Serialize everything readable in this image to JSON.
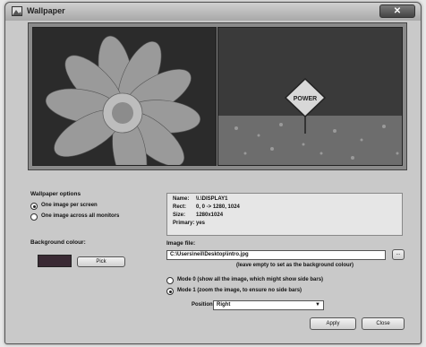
{
  "window": {
    "title": "Wallpaper",
    "close_glyph": "✕"
  },
  "preview": {
    "sign_text": "POWER"
  },
  "wallpaper_options": {
    "heading": "Wallpaper options",
    "options": [
      {
        "label": "One image per screen",
        "selected": true
      },
      {
        "label": "One image across all monitors",
        "selected": false
      }
    ]
  },
  "background_colour": {
    "label": "Background colour:",
    "swatch_color": "#3a2a34",
    "pick_label": "Pick"
  },
  "monitor_info": {
    "name_key": "Name:",
    "name_value": "\\\\.\\DISPLAY1",
    "rect_key": "Rect:",
    "rect_value": "0, 0 -> 1280, 1024",
    "size_key": "Size:",
    "size_value": "1280x1024",
    "primary_key": "Primary:",
    "primary_value": "yes"
  },
  "image_file": {
    "label": "Image file:",
    "value": "C:\\Users\\neil\\Desktop\\intro.jpg",
    "browse_label": "...",
    "hint": "(leave empty to set as the background colour)"
  },
  "modes": [
    {
      "label": "Mode 0 (show all the image, which might show side bars)",
      "selected": false
    },
    {
      "label": "Mode 1 (zoom the image, to ensure no side bars)",
      "selected": true
    }
  ],
  "position": {
    "label": "Position:",
    "value": "Right"
  },
  "buttons": {
    "apply": "Apply",
    "close": "Close"
  }
}
